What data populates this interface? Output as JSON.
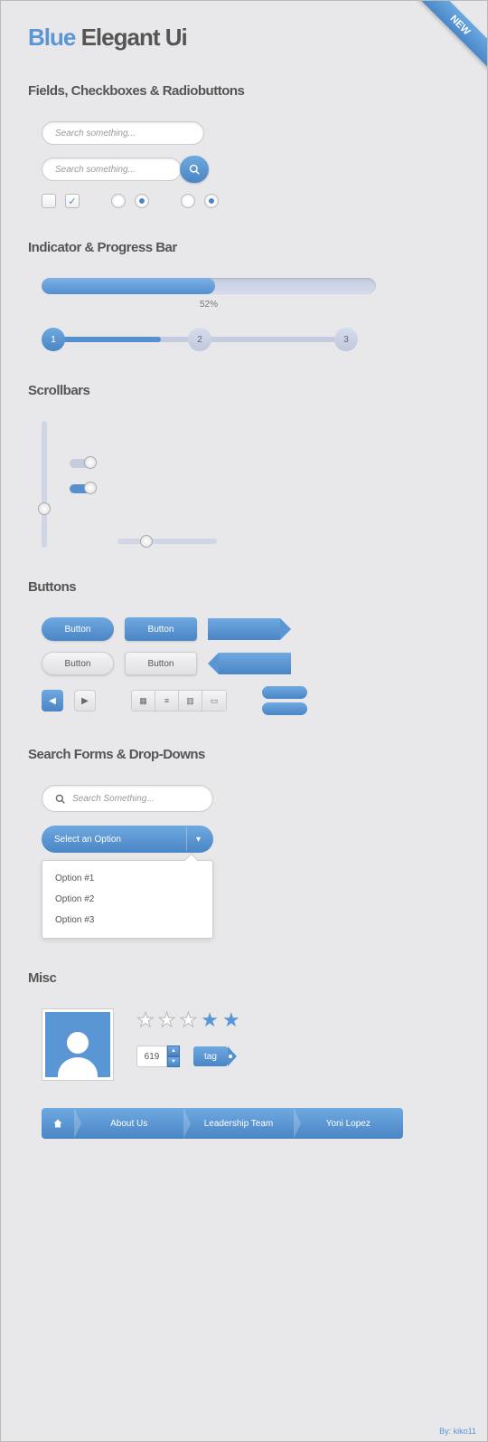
{
  "ribbon": "NEW",
  "title": {
    "blue": "Blue",
    "rest": "Elegant Ui"
  },
  "sections": {
    "fields": "Fields, Checkboxes & Radiobuttons",
    "progress": "Indicator & Progress Bar",
    "scrollbars": "Scrollbars",
    "buttons": "Buttons",
    "search": "Search Forms & Drop-Downs",
    "misc": "Misc"
  },
  "search": {
    "placeholder1": "Search something...",
    "placeholder2": "Search something...",
    "placeholder3": "Search Something..."
  },
  "progress": {
    "percent": 52,
    "label": "52%"
  },
  "steps": [
    "1",
    "2",
    "3"
  ],
  "buttons": {
    "label": "Button"
  },
  "dropdown": {
    "label": "Select an Option",
    "options": [
      "Option #1",
      "Option #2",
      "Option #3"
    ]
  },
  "stars": {
    "total": 5,
    "filled": 2
  },
  "stepper": "619",
  "tag": "tag",
  "breadcrumb": [
    "About Us",
    "Leadership Team",
    "Yoni Lopez"
  ],
  "credit": "By: kiko11"
}
